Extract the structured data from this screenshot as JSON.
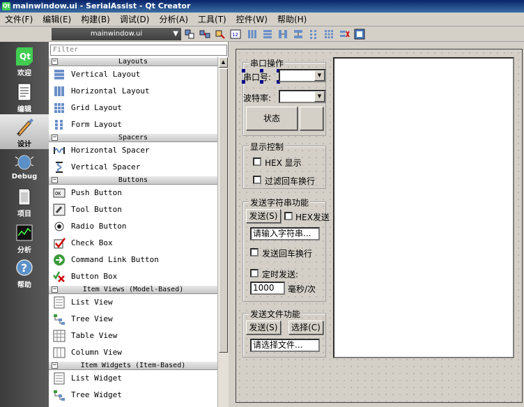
{
  "window": {
    "title": "mainwindow.ui - SerialAssist - Qt Creator"
  },
  "menu": [
    "文件(F)",
    "编辑(E)",
    "构建(B)",
    "调试(D)",
    "分析(A)",
    "工具(T)",
    "控件(W)",
    "帮助(H)"
  ],
  "modes": [
    {
      "label": "欢迎",
      "icon": "qt-logo-icon"
    },
    {
      "label": "编辑",
      "icon": "edit-document-icon"
    },
    {
      "label": "设计",
      "icon": "design-brush-icon",
      "active": true
    },
    {
      "label": "Debug",
      "icon": "debug-bug-icon"
    },
    {
      "label": "项目",
      "icon": "project-icon"
    },
    {
      "label": "分析",
      "icon": "analyze-icon"
    },
    {
      "label": "帮助",
      "icon": "help-icon"
    }
  ],
  "toolbar": {
    "file": "mainwindow.ui"
  },
  "widgetbox": {
    "filter_placeholder": "Filter",
    "categories": [
      {
        "title": "Layouts",
        "items": [
          "Vertical Layout",
          "Horizontal Layout",
          "Grid Layout",
          "Form Layout"
        ]
      },
      {
        "title": "Spacers",
        "items": [
          "Horizontal Spacer",
          "Vertical Spacer"
        ]
      },
      {
        "title": "Buttons",
        "items": [
          "Push Button",
          "Tool Button",
          "Radio Button",
          "Check Box",
          "Command Link Button",
          "Button Box"
        ]
      },
      {
        "title": "Item Views (Model-Based)",
        "items": [
          "List View",
          "Tree View",
          "Table View",
          "Column View"
        ]
      },
      {
        "title": "Item Widgets (Item-Based)",
        "items": [
          "List Widget",
          "Tree Widget"
        ]
      }
    ]
  },
  "form": {
    "serial_group": {
      "title": "串口操作",
      "port_label": "串口号:",
      "baud_label": "波特率:",
      "status_button": "状态"
    },
    "display_group": {
      "title": "显示控制",
      "hex_display": "HEX 显示",
      "filter_crlf": "过滤回车换行"
    },
    "send_group": {
      "title": "发送字符串功能",
      "send_button": "发送(S)",
      "hex_send": "HEX发送",
      "input_value": "请输入字符串...",
      "send_crlf": "发送回车换行",
      "timed_send": "定时发送:",
      "interval_value": "1000",
      "interval_unit": "毫秒/次"
    },
    "file_group": {
      "title": "发送文件功能",
      "send_button": "发送(S)",
      "choose_button": "选择(C)",
      "file_value": "请选择文件..."
    }
  }
}
